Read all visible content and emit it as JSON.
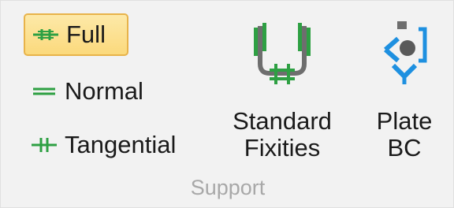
{
  "ribbon": {
    "group_label": "Support",
    "options": [
      {
        "label": "Full",
        "icon": "full-fixity-icon",
        "selected": true
      },
      {
        "label": "Normal",
        "icon": "normal-fixity-icon",
        "selected": false
      },
      {
        "label": "Tangential",
        "icon": "tangential-fixity-icon",
        "selected": false
      }
    ],
    "standard_fixities": {
      "line1": "Standard",
      "line2": "Fixities",
      "icon": "standard-fixities-icon"
    },
    "plate_bc": {
      "line1": "Plate",
      "line2": "BC",
      "icon": "plate-bc-icon"
    }
  },
  "colors": {
    "green": "#2ea043",
    "selected_bg": "#fbd97c",
    "selected_border": "#e8b34a",
    "blue": "#1e90e0",
    "gray": "#6e6e6e"
  }
}
